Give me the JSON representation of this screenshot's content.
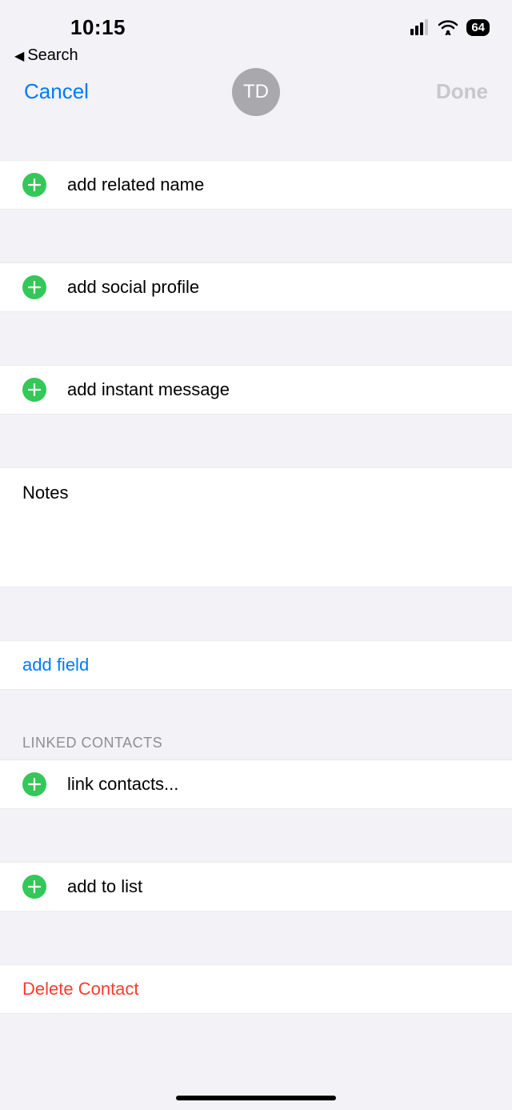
{
  "status": {
    "time": "10:15",
    "battery": "64",
    "back_label": "Search"
  },
  "nav": {
    "cancel": "Cancel",
    "done": "Done",
    "avatar_initials": "TD"
  },
  "rows": {
    "related_name": "add related name",
    "social_profile": "add social profile",
    "instant_message": "add instant message",
    "notes_label": "Notes",
    "add_field": "add field",
    "linked_header": "LINKED CONTACTS",
    "link_contacts": "link contacts...",
    "add_to_list": "add to list",
    "delete_contact": "Delete Contact"
  }
}
